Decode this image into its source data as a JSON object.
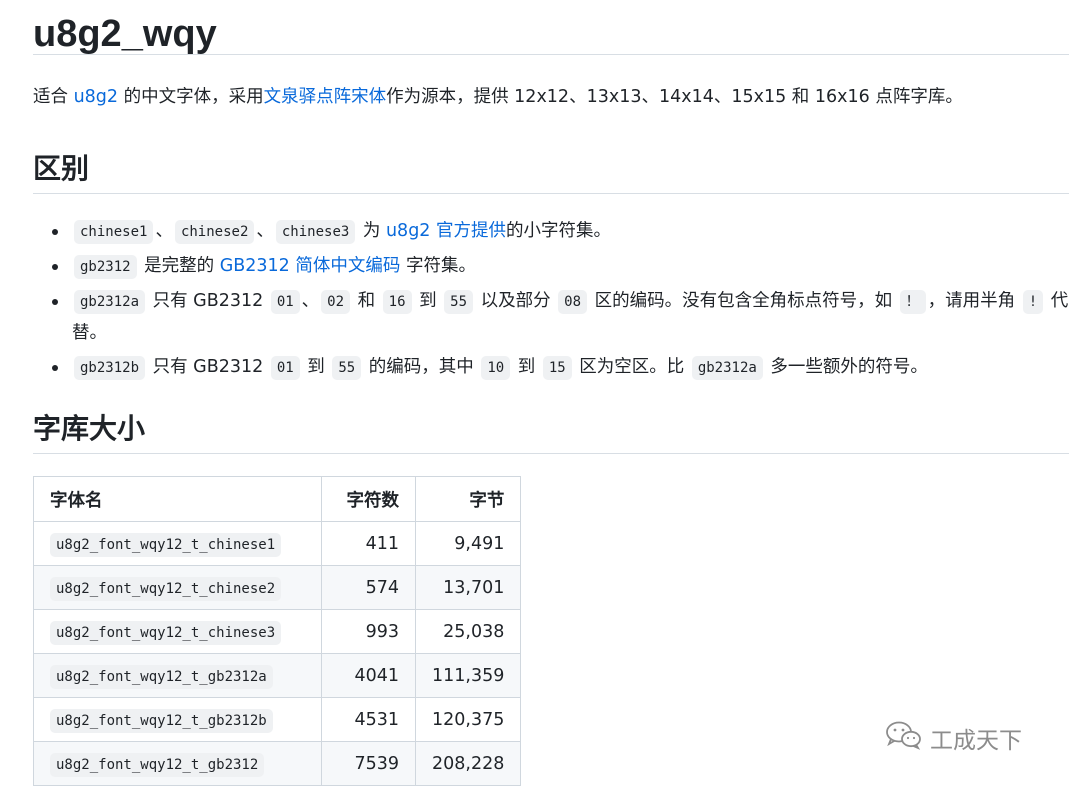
{
  "title": "u8g2_wqy",
  "intro": {
    "p1": "适合 ",
    "link1": "u8g2",
    "p2": " 的中文字体，采用",
    "link2": "文泉驿点阵宋体",
    "p3": "作为源本，提供 12x12、13x13、14x14、15x15 和 16x16 点阵字库。"
  },
  "section_diff": {
    "heading": "区别",
    "item1": {
      "c1": "chinese1",
      "s1": "、",
      "c2": "chinese2",
      "s2": "、",
      "c3": "chinese3",
      "t1": "为 ",
      "link": "u8g2 官方提供",
      "t2": "的小字符集。"
    },
    "item2": {
      "c1": "gb2312",
      "t1": " 是完整的 ",
      "link": "GB2312 简体中文编码",
      "t2": " 字符集。"
    },
    "item3": {
      "c1": "gb2312a",
      "t1": " 只有 GB2312 ",
      "c2": "01",
      "t2": "、",
      "c3": "02",
      "t3": " 和 ",
      "c4": "16",
      "t4": " 到 ",
      "c5": "55",
      "t5": " 以及部分 ",
      "c6": "08",
      "t6": " 区的编码。没有包含全角标点符号，如 ",
      "c7": "！",
      "t7": "，请用半角 ",
      "c8": "!",
      "t8": " 代替。"
    },
    "item4": {
      "c1": "gb2312b",
      "t1": " 只有 GB2312 ",
      "c2": "01",
      "t2": " 到 ",
      "c3": "55",
      "t3": " 的编码，其中 ",
      "c4": "10",
      "t4": " 到 ",
      "c5": "15",
      "t5": " 区为空区。比 ",
      "c6": "gb2312a",
      "t6": " 多一些额外的符号。"
    }
  },
  "section_size": {
    "heading": "字库大小",
    "table": {
      "headers": [
        "字体名",
        "字符数",
        "字节"
      ],
      "rows": [
        [
          "u8g2_font_wqy12_t_chinese1",
          "411",
          "9,491"
        ],
        [
          "u8g2_font_wqy12_t_chinese2",
          "574",
          "13,701"
        ],
        [
          "u8g2_font_wqy12_t_chinese3",
          "993",
          "25,038"
        ],
        [
          "u8g2_font_wqy12_t_gb2312a",
          "4041",
          "111,359"
        ],
        [
          "u8g2_font_wqy12_t_gb2312b",
          "4531",
          "120,375"
        ],
        [
          "u8g2_font_wqy12_t_gb2312",
          "7539",
          "208,228"
        ]
      ]
    }
  },
  "watermark": {
    "text": "工成天下",
    "icon": "wechat-icon"
  },
  "colors": {
    "link": "#0969da",
    "text": "#1f2328",
    "code_bg": "#eff1f3",
    "border": "#d0d7de"
  }
}
